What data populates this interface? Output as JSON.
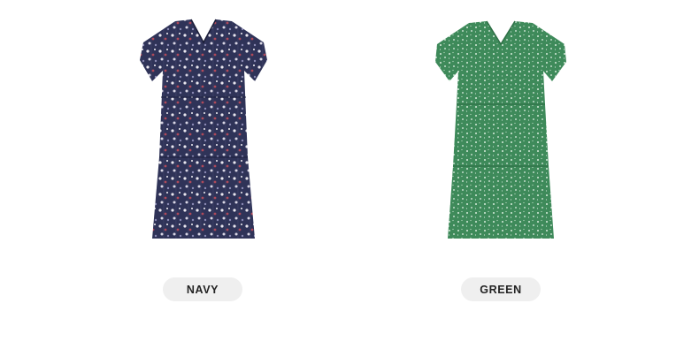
{
  "variants": [
    {
      "label": "NAVY",
      "color": "#2f3358",
      "accent_colors": [
        "#e9e6ee",
        "#b04a5a",
        "#8a89b3"
      ],
      "icon": "navy-floral-dress"
    },
    {
      "label": "GREEN",
      "color": "#3e8a5a",
      "accent_colors": [
        "#d7ecdc",
        "#2d6e45"
      ],
      "icon": "green-dotted-dress"
    }
  ]
}
